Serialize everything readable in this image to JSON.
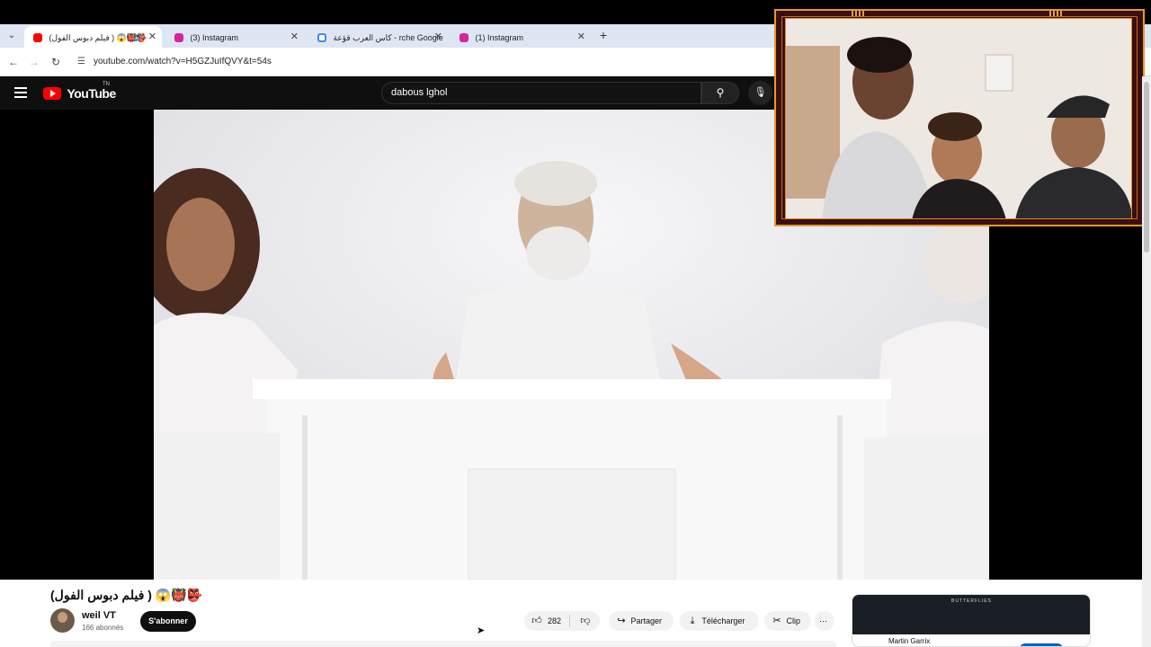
{
  "browser": {
    "tabs": [
      {
        "title": "(فيلم دبوس الفول ) 😱👹👺",
        "active": true,
        "favicon": "youtube-icon",
        "favicon_color": "#ff0000",
        "audio": true
      },
      {
        "title": "(3) Instagram",
        "active": false,
        "favicon": "instagram-icon",
        "favicon_color": "#d6249f"
      },
      {
        "title": "كاس العرب قؤعة - rche Google",
        "active": false,
        "favicon": "google-icon",
        "favicon_color": "#4285f4"
      },
      {
        "title": "(1) Instagram",
        "active": false,
        "favicon": "instagram-icon",
        "favicon_color": "#d6249f"
      }
    ],
    "url": "youtube.com/watch?v=H5GZJuIfQVY&t=54s"
  },
  "youtube": {
    "logo_text": "YouTube",
    "logo_suffix": "TN",
    "search_value": "dabous lghol"
  },
  "video": {
    "title": "(فيلم دبوس الفول ) 😱👹👺",
    "channel": "weil VT",
    "subscribers": "166 abonnés",
    "subscribe_label": "S'abonner",
    "likes": "282",
    "share_label": "Partager",
    "download_label": "Télécharger",
    "clip_label": "Clip",
    "more_label": "⋯"
  },
  "sidebar": {
    "first_card_thumbnail_title": "BUTTERFLIES",
    "first_card_author": "Martin Garrix"
  },
  "colors": {
    "brand": "#ff0000",
    "cam_border": "#e49a2b",
    "cam_frame": "#3a0f10"
  }
}
